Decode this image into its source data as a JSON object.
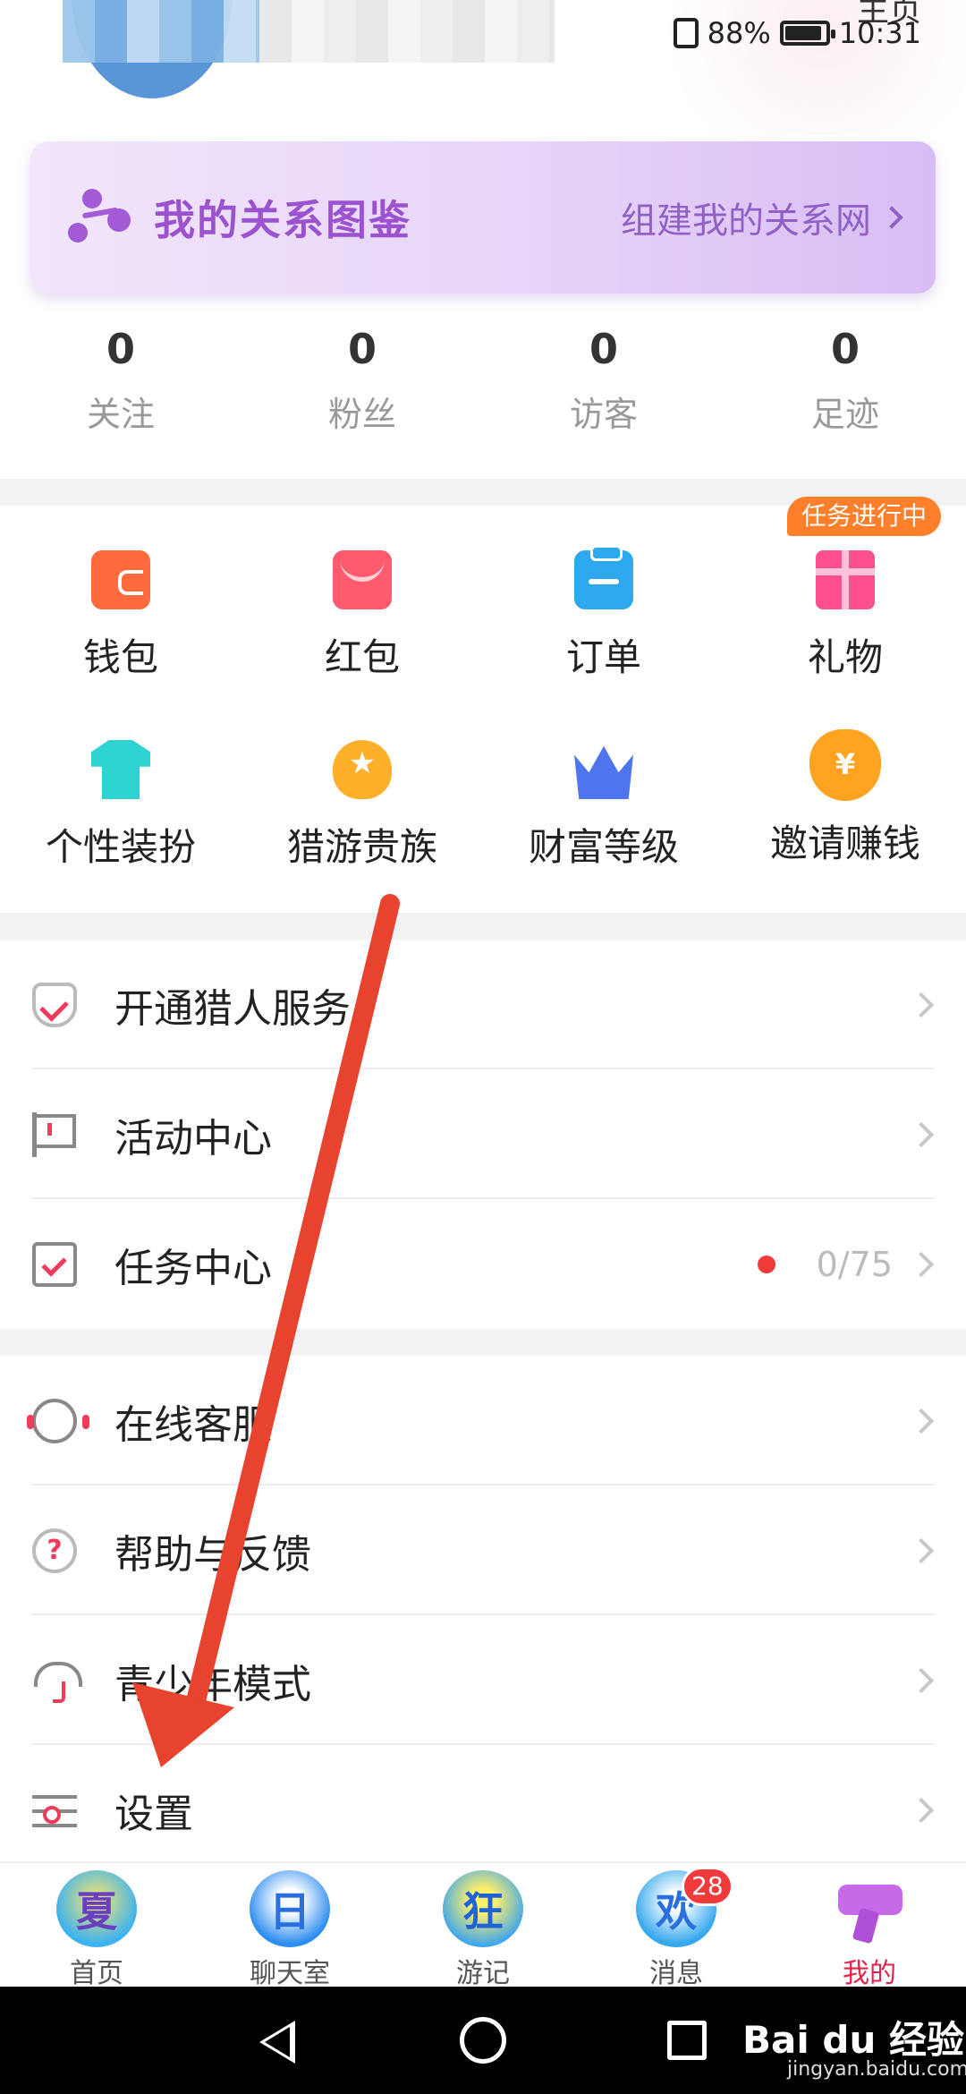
{
  "status_bar": {
    "battery": "88%",
    "time": "10:31"
  },
  "header": {
    "home_link": "主页"
  },
  "relation_banner": {
    "title": "我的关系图鉴",
    "action": "组建我的关系网"
  },
  "stats": [
    {
      "value": "0",
      "label": "关注"
    },
    {
      "value": "0",
      "label": "粉丝"
    },
    {
      "value": "0",
      "label": "访客"
    },
    {
      "value": "0",
      "label": "足迹"
    }
  ],
  "grid": {
    "task_badge": "任务进行中",
    "items": [
      {
        "label": "钱包",
        "icon": "wallet-icon"
      },
      {
        "label": "红包",
        "icon": "red-packet-icon"
      },
      {
        "label": "订单",
        "icon": "order-icon"
      },
      {
        "label": "礼物",
        "icon": "gift-icon"
      },
      {
        "label": "个性装扮",
        "icon": "shirt-icon"
      },
      {
        "label": "猎游贵族",
        "icon": "noble-badge-icon"
      },
      {
        "label": "财富等级",
        "icon": "crown-icon"
      },
      {
        "label": "邀请赚钱",
        "icon": "money-bag-icon"
      }
    ]
  },
  "list_a": [
    {
      "label": "开通猎人服务",
      "icon": "shield-check-icon"
    },
    {
      "label": "活动中心",
      "icon": "flag-icon"
    },
    {
      "label": "任务中心",
      "icon": "task-clipboard-icon",
      "count": "0/75"
    }
  ],
  "list_b": [
    {
      "label": "在线客服",
      "icon": "headset-icon"
    },
    {
      "label": "帮助与反馈",
      "icon": "help-icon"
    },
    {
      "label": "青少年模式",
      "icon": "umbrella-icon"
    },
    {
      "label": "设置",
      "icon": "settings-sliders-icon"
    }
  ],
  "tabbar": {
    "active": "我的",
    "tabs": [
      {
        "label": "首页",
        "glyph": "夏"
      },
      {
        "label": "聊天室",
        "glyph": "日"
      },
      {
        "label": "游记",
        "glyph": "狂"
      },
      {
        "label": "消息",
        "glyph": "欢",
        "badge": "28"
      },
      {
        "label": "我的",
        "glyph": ""
      }
    ]
  },
  "watermark": {
    "brand": "Bai du 经验",
    "url": "jingyan.baidu.com"
  },
  "colors": {
    "accent_red": "#e2244a",
    "banner_purple": "#9b52cf",
    "arrow_red": "#e8432e",
    "badge_orange": "#ff7f2a"
  }
}
